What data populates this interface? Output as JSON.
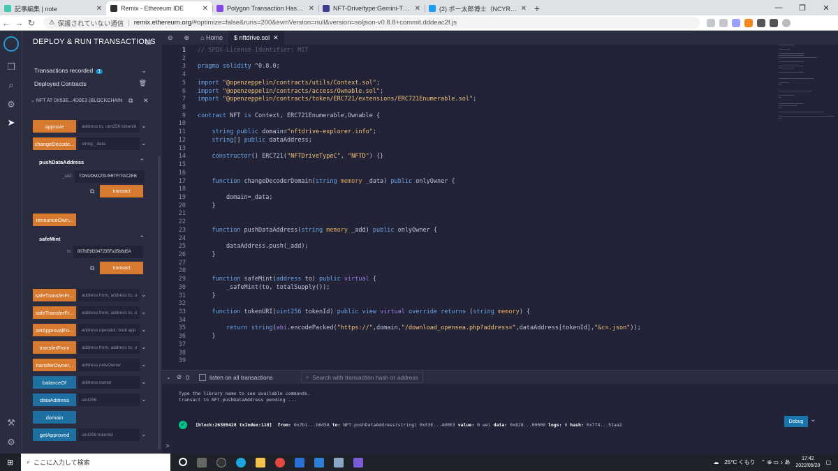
{
  "browser": {
    "tabs": [
      {
        "title": "記事編集 | note",
        "color": "#41c9b4",
        "active": false
      },
      {
        "title": "Remix - Ethereum IDE",
        "color": "#2f2f2f",
        "active": true
      },
      {
        "title": "Polygon Transaction Hash (Txha",
        "color": "#8247e5",
        "active": false
      },
      {
        "title": "NFT-Drive/type:Gemini-TEST_NE",
        "color": "#3b3b8f",
        "active": false
      },
      {
        "title": "(2) ボー太郎博士（NCYRHFYAW",
        "color": "#1d9bf0",
        "active": false
      }
    ],
    "new_tab": "+",
    "security_warning": "保護されていない通信",
    "url_host": "remix.ethereum.org",
    "url_rest": "/#optimize=false&runs=200&evmVersion=null&version=soljson-v0.8.8+commit.dddeac2f.js"
  },
  "sidebar": {
    "title": "DEPLOY & RUN TRANSACTIONS",
    "transactions_recorded": "Transactions recorded",
    "transactions_count": "1",
    "deployed_contracts": "Deployed Contracts",
    "instance": "NFT AT 0X53E...4D0E3 (BLOCKCHAIN",
    "functions": [
      {
        "label": "approve",
        "placeholder": "address to, uint256 tokenId",
        "color": "orange"
      },
      {
        "label": "changeDecode...",
        "placeholder": "string _data",
        "color": "orange"
      }
    ],
    "push": {
      "title": "pushDataAddress",
      "param": "_add:",
      "value": "TDNUDMXZSU5RTFITGCZEB",
      "button": "transact"
    },
    "renounce": "renounceOwn...",
    "safemint": {
      "title": "safeMint",
      "param": "to:",
      "value": "807bE6f3347235Fa35b6d5A",
      "button": "transact"
    },
    "functions2": [
      {
        "label": "safeTransferFr...",
        "placeholder": "address from, address to, u",
        "color": "orange"
      },
      {
        "label": "safeTransferFr...",
        "placeholder": "address from, address to, u",
        "color": "orange"
      },
      {
        "label": "setApprovalFo...",
        "placeholder": "address operator, bool app",
        "color": "orange"
      },
      {
        "label": "transferFrom",
        "placeholder": "address from, address to, u",
        "color": "orange"
      },
      {
        "label": "transferOwner...",
        "placeholder": "address newOwner",
        "color": "orange"
      },
      {
        "label": "balanceOf",
        "placeholder": "address owner",
        "color": "blue"
      },
      {
        "label": "dataAddress",
        "placeholder": "uint256",
        "color": "blue"
      },
      {
        "label": "domain",
        "placeholder": "",
        "color": "blue"
      },
      {
        "label": "getApproved",
        "placeholder": "uint256 tokenId",
        "color": "blue"
      }
    ]
  },
  "editor": {
    "tab_home": "Home",
    "tab_file": "nftdrive.sol",
    "lines": [
      "// SPDX-License-Identifier: MIT",
      "",
      "pragma solidity ^0.8.0;",
      "",
      "import \"@openzeppelin/contracts/utils/Context.sol\";",
      "import \"@openzeppelin/contracts/access/Ownable.sol\";",
      "import \"@openzeppelin/contracts/token/ERC721/extensions/ERC721Enumerable.sol\";",
      "",
      "contract NFT is Context, ERC721Enumerable,Ownable {",
      "",
      "    string public domain=\"nftdrive-explorer.info\";",
      "    string[] public dataAddress;",
      "",
      "    constructor() ERC721(\"NFTDriveTypeC\", \"NFTD\") {}",
      "",
      "",
      "    function changeDecoderDomain(string memory _data) public onlyOwner {",
      "",
      "        domain=_data;",
      "    }",
      "",
      "",
      "    function pushDataAddress(string memory _add) public onlyOwner {",
      "",
      "        dataAddress.push(_add);",
      "    }",
      "",
      "",
      "    function safeMint(address to) public virtual {",
      "        _safeMint(to, totalSupply());",
      "    }",
      "",
      "    function tokenURI(uint256 tokenId) public view virtual override returns (string memory) {",
      "",
      "        return string(abi.encodePacked(\"https://\",domain,\"/download_opensea.php?address=\",dataAddress[tokenId],\"&c=.json\"));",
      "    }",
      "",
      "",
      ""
    ]
  },
  "terminal": {
    "count": "0",
    "listen_label": "listen on all transactions",
    "search_placeholder": "Search with transaction hash or address",
    "line1": "Type the library name to see available commands.",
    "line2": "transact to NFT.pushDataAddress pending ...",
    "tx_block": "[block:26389428 txIndex:118]",
    "tx_from_label": "from:",
    "tx_from": "0x7b1...b6d5A",
    "tx_to_label": "to:",
    "tx_to": "NFT.pushDataAddress(string) 0x53E...4d0E3",
    "tx_value_label": "value:",
    "tx_value": "0 wei",
    "tx_data_label": "data:",
    "tx_data": "0x828...00000",
    "tx_logs_label": "logs:",
    "tx_logs": "0",
    "tx_hash_label": "hash:",
    "tx_hash": "0x7f4...51aa2",
    "debug": "Debug",
    "prompt": ">"
  },
  "taskbar": {
    "search": "ここに入力して検索",
    "weather": "25°C くもり",
    "time": "17:42",
    "date": "2022/05/20"
  }
}
